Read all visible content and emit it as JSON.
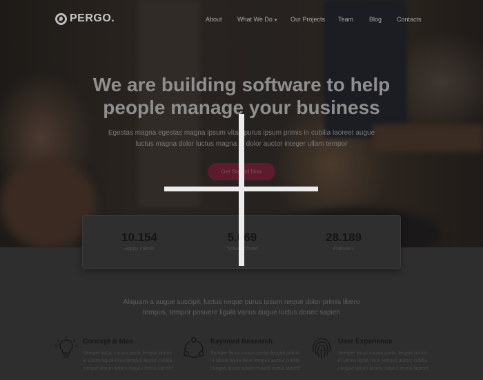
{
  "brand": {
    "name": "PERGO.",
    "icon": "pergo-logo-icon"
  },
  "nav": {
    "items": [
      {
        "label": "About"
      },
      {
        "label": "What We Do",
        "dropdown": true,
        "icon": "chevron-down-icon"
      },
      {
        "label": "Our Projects"
      },
      {
        "label": "Team"
      },
      {
        "label": "Blog"
      },
      {
        "label": "Contacts"
      }
    ]
  },
  "hero": {
    "headline_line1": "We are building software to help",
    "headline_line2": "people manage your business",
    "sub_line1": "Egestas magna egestas magna ipsum vitae purus ipsum primis in cubilia laoreet augue",
    "sub_line2": "luctus magna dolor luctus magna id dolor auctor integer ullam tempor",
    "cta_label": "Get Started Now"
  },
  "stats": [
    {
      "value": "10.154",
      "label": "Happy Clients"
    },
    {
      "value": "5.069",
      "label": "Tickets Closed"
    },
    {
      "value": "28.189",
      "label": "Followers"
    }
  ],
  "intro": {
    "line1": "Aliquam a augue suscipit, luctus neque purus ipsum neque dolor primis libero",
    "line2": "tempus, tempor posuere ligula varius augue luctus donec sapien"
  },
  "features": [
    {
      "title": "Concept & Idea",
      "icon": "lightbulb-icon",
      "text": "Semper lacus cursus porta, feugiat primis in ultrice ligula risus tempus auctor cubilia congue ipsum ipsum mauris lectus laoreet"
    },
    {
      "title": "Keyword Research",
      "icon": "network-nodes-icon",
      "text": "Semper lacus cursus porta, feugiat primis in ultrice ligula risus tempus auctor cubilia congue ipsum ipsum mauris lectus laoreet"
    },
    {
      "title": "User Experience",
      "icon": "fingerprint-icon",
      "text": "Semper lacus cursus porta, feugiat primis in ultrice ligula risus tempus auctor cubilia congue ipsum ipsum mauris lectus laoreet"
    }
  ],
  "colors": {
    "accent": "#8b1c3c",
    "overlay": "#000000"
  }
}
